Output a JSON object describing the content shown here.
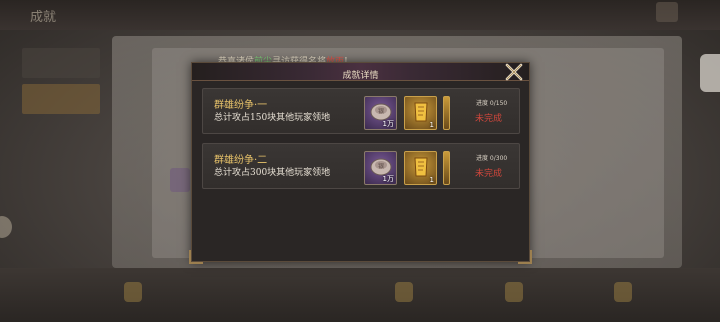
{
  "background": {
    "window_title": "成就",
    "tabs": [
      "",
      ""
    ]
  },
  "notice": {
    "prefix": "恭喜诸侯",
    "player": "前尘",
    "middle": "寻访获得名将",
    "general": "放丙",
    "suffix": "!"
  },
  "dialog": {
    "title": "成就详情",
    "rows": [
      {
        "name": "群雄纷争·一",
        "desc": "总计攻占150块其他玩家领地",
        "rewards": [
          {
            "icon": "silver-ingot-icon",
            "qty": "1万"
          },
          {
            "icon": "golden-scroll-icon",
            "qty": "1"
          }
        ],
        "progress": "进度 0/150",
        "status": "未完成"
      },
      {
        "name": "群雄纷争·二",
        "desc": "总计攻占300块其他玩家领地",
        "rewards": [
          {
            "icon": "silver-ingot-icon",
            "qty": "1万"
          },
          {
            "icon": "golden-scroll-icon",
            "qty": "1"
          }
        ],
        "progress": "进度 0/300",
        "status": "未完成"
      }
    ]
  },
  "colors": {
    "name_gold": "#e8c36a",
    "status_red": "#d0473c",
    "highlight_green": "#7fd27a",
    "highlight_red": "#e8554a"
  }
}
